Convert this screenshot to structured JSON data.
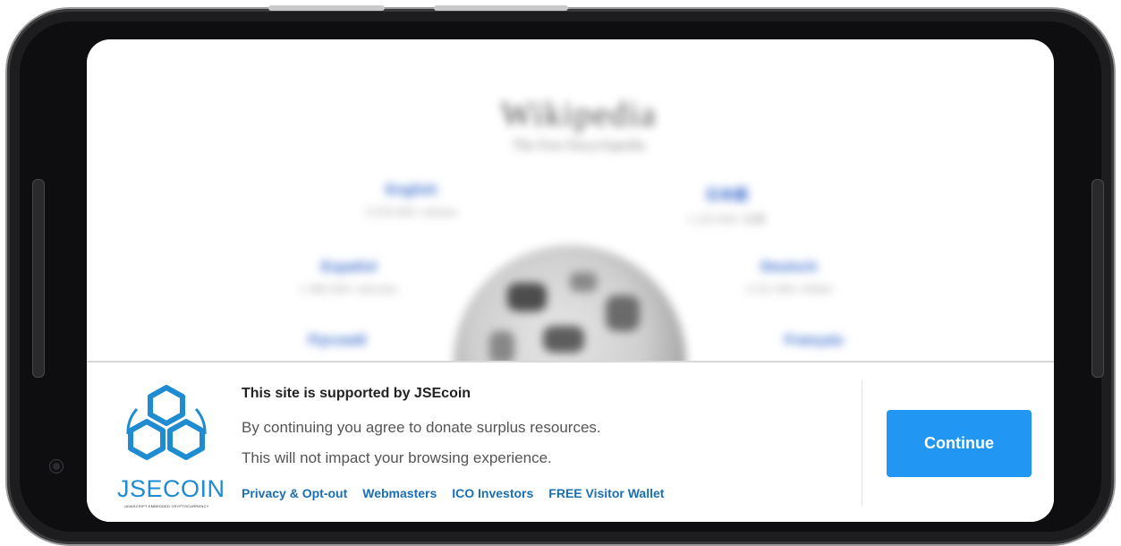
{
  "background_site": {
    "title": "Wikipedia",
    "subtitle": "The Free Encyclopedia",
    "languages": [
      {
        "name": "English",
        "count": "5 678 000+ articles"
      },
      {
        "name": "日本語",
        "count": "1 123 000+ 記事"
      },
      {
        "name": "Español",
        "count": "1 466 000+ artículos"
      },
      {
        "name": "Deutsch",
        "count": "2 211 000+ Artikel"
      },
      {
        "name": "Русский",
        "count": ""
      },
      {
        "name": "Français",
        "count": ""
      }
    ]
  },
  "banner": {
    "logo": {
      "text": "JSECOIN",
      "tagline": "JAVASCRIPT EMBEDDED CRYPTOCURRENCY"
    },
    "title": "This site is supported by JSEcoin",
    "line1": "By continuing you agree to donate surplus resources.",
    "line2": "This will not impact your browsing experience.",
    "links": [
      "Privacy & Opt-out",
      "Webmasters",
      "ICO Investors",
      "FREE Visitor Wallet"
    ],
    "continue_label": "Continue"
  },
  "colors": {
    "accent": "#2196f3",
    "link": "#1a6fb3",
    "logo": "#1f8bd0"
  }
}
